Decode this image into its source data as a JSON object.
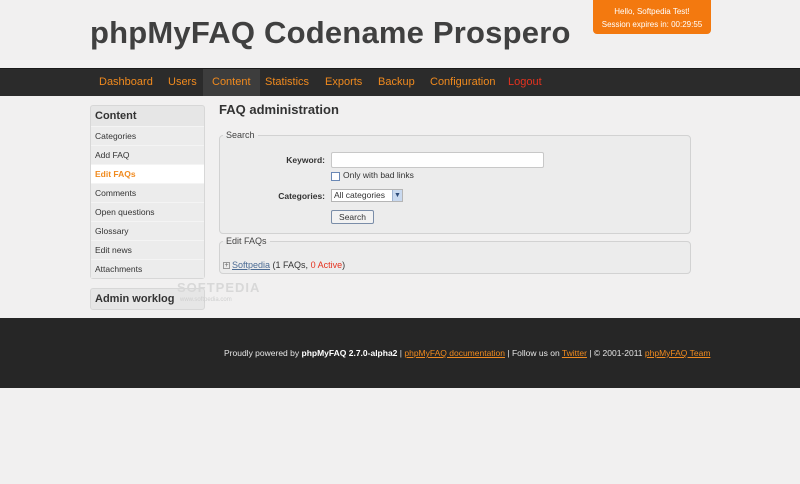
{
  "header": {
    "title": "phpMyFAQ Codename Prospero",
    "greeting": "Hello, Softpedia Test!",
    "session": "Session expires in: 00:29:55"
  },
  "nav": {
    "items": [
      "Dashboard",
      "Users",
      "Content",
      "Statistics",
      "Exports",
      "Backup",
      "Configuration",
      "Logout"
    ],
    "active": "Content"
  },
  "sidebar": {
    "heading": "Content",
    "items": [
      "Categories",
      "Add FAQ",
      "Edit FAQs",
      "Comments",
      "Open questions",
      "Glossary",
      "Edit news",
      "Attachments"
    ],
    "active": "Edit FAQs",
    "worklog_heading": "Admin worklog"
  },
  "main": {
    "title": "FAQ administration",
    "search": {
      "legend": "Search",
      "keyword_label": "Keyword:",
      "keyword_value": "",
      "bad_links_label": "Only with bad links",
      "bad_links_checked": false,
      "categories_label": "Categories:",
      "categories_selected": "All categories",
      "button": "Search"
    },
    "edit": {
      "legend": "Edit FAQs",
      "category": "Softpedia",
      "count_text": "(1 FAQs,",
      "active_text": "0 Active",
      "close_paren": ")"
    }
  },
  "watermark": {
    "text": "SOFTPEDIA",
    "sub": "www.softpedia.com"
  },
  "footer": {
    "prefix": "Proudly powered by",
    "version": "phpMyFAQ 2.7.0-alpha2",
    "sep1": "|",
    "doc_link": "phpMyFAQ documentation",
    "sep2": "| Follow us on",
    "twitter_link": "Twitter",
    "copyright": "| © 2001-2011",
    "team_link": "phpMyFAQ Team"
  },
  "colors": {
    "accent": "#f08a1e",
    "session_bg": "#f3790f",
    "logout": "#e5321f",
    "navbar": "#2b2b2b",
    "footer": "#262626"
  }
}
